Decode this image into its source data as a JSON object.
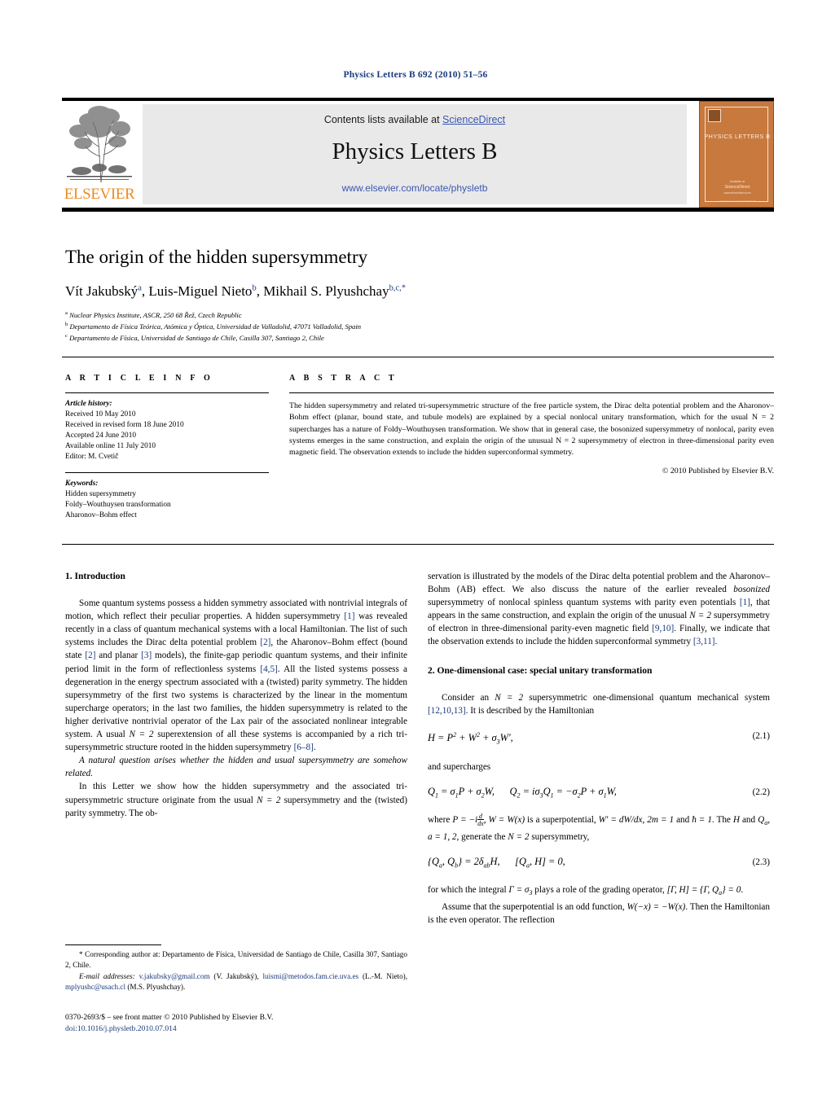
{
  "running_head": "Physics Letters B 692 (2010) 51–56",
  "masthead": {
    "contents_prefix": "Contents lists available at ",
    "sciencedirect": "ScienceDirect",
    "journal_title": "Physics Letters B",
    "journal_url": "www.elsevier.com/locate/physletb",
    "publisher_wordmark": "ELSEVIER",
    "cover": {
      "title": "PHYSICS LETTERS B",
      "foot1": "Available at",
      "foot2": "ScienceDirect",
      "foot3": "www.sciencedirect.com",
      "foot4": "www.elsevier.com/locate/physletb"
    }
  },
  "accent_colors": {
    "link_blue": "#3a56b0",
    "ref_blue": "#1a3a7a",
    "elsevier_orange": "#ED8B1D",
    "cover_orange": "#c8793e",
    "panel_gray": "#e9e9e9"
  },
  "article": {
    "title": "The origin of the hidden supersymmetry",
    "authors": [
      {
        "name": "Vít Jakubský",
        "marks": "a"
      },
      {
        "name": "Luis-Miguel Nieto",
        "marks": "b"
      },
      {
        "name": "Mikhail S. Plyushchay",
        "marks": "b,c,*"
      }
    ],
    "affiliations": [
      {
        "mark": "a",
        "text": "Nuclear Physics Institute, ASCR, 250 68 Řež, Czech Republic"
      },
      {
        "mark": "b",
        "text": "Departamento de Física Teórica, Atómica y Óptica, Universidad de Valladolid, 47071 Valladolid, Spain"
      },
      {
        "mark": "c",
        "text": "Departamento de Física, Universidad de Santiago de Chile, Casilla 307, Santiago 2, Chile"
      }
    ]
  },
  "article_info": {
    "heading": "A R T I C L E    I N F O",
    "history_label": "Article history:",
    "history": [
      "Received 10 May 2010",
      "Received in revised form 18 June 2010",
      "Accepted 24 June 2010",
      "Available online 11 July 2010",
      "Editor: M. Cvetič"
    ],
    "keywords_label": "Keywords:",
    "keywords": [
      "Hidden supersymmetry",
      "Foldy–Wouthuysen transformation",
      "Aharonov–Bohm effect"
    ]
  },
  "abstract": {
    "heading": "A B S T R A C T",
    "text": "The hidden supersymmetry and related tri-supersymmetric structure of the free particle system, the Dirac delta potential problem and the Aharonov–Bohm effect (planar, bound state, and tubule models) are explained by a special nonlocal unitary transformation, which for the usual N = 2 supercharges has a nature of Foldy–Wouthuysen transformation. We show that in general case, the bosonized supersymmetry of nonlocal, parity even systems emerges in the same construction, and explain the origin of the unusual N = 2 supersymmetry of electron in three-dimensional parity even magnetic field. The observation extends to include the hidden superconformal symmetry.",
    "copyright": "© 2010 Published by Elsevier B.V."
  },
  "body": {
    "section1_heading": "1. Introduction",
    "section2_heading": "2. One-dimensional case: special unitary transformation",
    "left_p1_a": "Some quantum systems possess a hidden symmetry associated with nontrivial integrals of motion, which reflect their peculiar properties. A hidden supersymmetry ",
    "left_p1_r1": "[1]",
    "left_p1_b": " was revealed recently in a class of quantum mechanical systems with a local Hamiltonian. The list of such systems includes the Dirac delta potential problem ",
    "left_p1_r2": "[2]",
    "left_p1_c": ", the Aharonov–Bohm effect (bound state ",
    "left_p1_r3": "[2]",
    "left_p1_d": " and planar ",
    "left_p1_r4": "[3]",
    "left_p1_e": " models), the finite-gap periodic quantum systems, and their infinite period limit in the form of reflectionless systems ",
    "left_p1_r5": "[4,5]",
    "left_p1_f": ". All the listed systems possess a degeneration in the energy spectrum associated with a (twisted) parity symmetry. The hidden supersymmetry of the first two systems is characterized by the linear in the momentum supercharge operators; in the last two families, the hidden supersymmetry is related to the higher derivative nontrivial operator of the Lax pair of the associated nonlinear integrable system. A usual ",
    "left_p1_math": "N = 2",
    "left_p1_g": " superextension of all these systems is accompanied by a rich tri-supersymmetric structure rooted in the hidden supersymmetry ",
    "left_p1_r6": "[6–8]",
    "left_p1_h": ".",
    "left_p2": "A natural question arises whether the hidden and usual supersymmetry are somehow related.",
    "left_p3_a": "In this Letter we show how the hidden supersymmetry and the associated tri-supersymmetric structure originate from the usual ",
    "left_p3_math": "N = 2",
    "left_p3_b": " supersymmetry and the (twisted) parity symmetry. The ob-",
    "right_p1_a": "servation is illustrated by the models of the Dirac delta potential problem and the Aharonov–Bohm (AB) effect. We also discuss the nature of the earlier revealed ",
    "right_p1_ital": "bosonized",
    "right_p1_b": " supersymmetry of nonlocal spinless quantum systems with parity even potentials ",
    "right_p1_r1": "[1]",
    "right_p1_c": ", that appears in the same construction, and explain the origin of the unusual ",
    "right_p1_math": "N = 2",
    "right_p1_d": " supersymmetry of electron in three-dimensional parity-even magnetic field ",
    "right_p1_r2": "[9,10]",
    "right_p1_e": ". Finally, we indicate that the observation extends to include the hidden superconformal symmetry ",
    "right_p1_r3": "[3,11]",
    "right_p1_f": ".",
    "right_p2_a": "Consider an ",
    "right_p2_math": "N = 2",
    "right_p2_b": " supersymmetric one-dimensional quantum mechanical system ",
    "right_p2_r1": "[12,10,13]",
    "right_p2_c": ". It is described by the Hamiltonian",
    "right_p3": "and supercharges",
    "right_p4_a": "where ",
    "right_p4_b": " is a superpotential, ",
    "right_p4_c": ", ",
    "right_p4_d": " and ",
    "right_p4_e": ". The ",
    "right_p4_f": " and ",
    "right_p4_g": ", ",
    "right_p4_h": ", generate the ",
    "right_p4_i": " supersymmetry,",
    "right_p5_a": "for which the integral ",
    "right_p5_b": " plays a role of the grading operator, ",
    "right_p5_c": ".",
    "right_p6_a": "Assume that the superpotential is an odd function, ",
    "right_p6_b": ". Then the Hamiltonian is the even operator. The reflection"
  },
  "equations": [
    {
      "id": "2.1",
      "label": "(2.1)"
    },
    {
      "id": "2.2",
      "label": "(2.2)"
    },
    {
      "id": "2.3",
      "label": "(2.3)"
    }
  ],
  "footnotes": {
    "corresponding_mark": "*",
    "corresponding_text": "Corresponding author at: Departamento de Física, Universidad de Santiago de Chile, Casilla 307, Santiago 2, Chile.",
    "email_label": "E-mail addresses:",
    "emails": [
      {
        "address": "v.jakubsky@gmail.com",
        "person": "(V. Jakubský)"
      },
      {
        "address": "luismi@metodos.fam.cie.uva.es",
        "person": "(L.-M. Nieto)"
      },
      {
        "address": "mplyushc@usach.cl",
        "person": "(M.S. Plyushchay)"
      }
    ]
  },
  "imprint": {
    "line1": "0370-2693/$ – see front matter © 2010 Published by Elsevier B.V.",
    "doi": "doi:10.1016/j.physletb.2010.07.014"
  }
}
